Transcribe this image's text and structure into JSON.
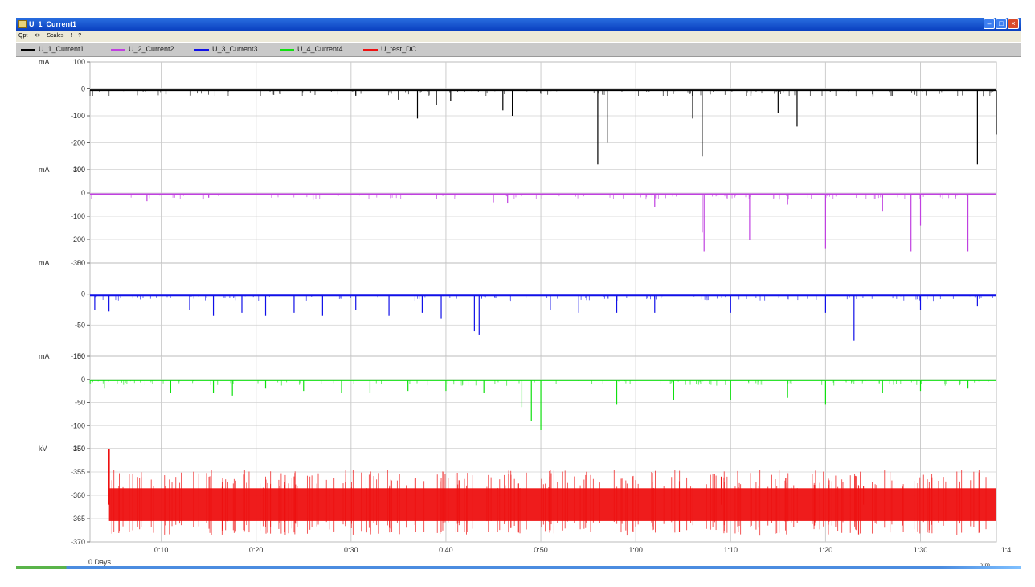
{
  "window": {
    "title": "U_1_Current1",
    "icon": "app-icon",
    "controls": [
      "minimize-icon",
      "maximize-icon",
      "close-icon"
    ]
  },
  "menu": {
    "items": [
      "Qpt",
      "<>",
      "Scales",
      "!",
      "?"
    ]
  },
  "legend": {
    "items": [
      {
        "label": "U_1_Current1",
        "color": "#000000"
      },
      {
        "label": "U_2_Current2",
        "color": "#c040e0"
      },
      {
        "label": "U_3_Current3",
        "color": "#1010e8"
      },
      {
        "label": "U_4_Current4",
        "color": "#10e010"
      },
      {
        "label": "U_test_DC",
        "color": "#ee1010"
      }
    ]
  },
  "x_axis": {
    "ticks": [
      "0:10",
      "0:20",
      "0:30",
      "0:40",
      "0:50",
      "1:00",
      "1:10",
      "1:20",
      "1:30",
      "1:4"
    ],
    "start_label": "0 Days",
    "unit": "h:m"
  },
  "chart_data": [
    {
      "type": "line",
      "series": [
        {
          "name": "U_1_Current1",
          "color": "#000000",
          "baseline": -5,
          "dips": [
            [
              10.5,
              -20
            ],
            [
              30.5,
              -25
            ],
            [
              35,
              -40
            ],
            [
              37,
              -110
            ],
            [
              39,
              -60
            ],
            [
              40.5,
              -45
            ],
            [
              46,
              -80
            ],
            [
              47,
              -100
            ],
            [
              56,
              -280
            ],
            [
              57,
              -200
            ],
            [
              66,
              -110
            ],
            [
              67,
              -250
            ],
            [
              75,
              -90
            ],
            [
              77,
              -140
            ],
            [
              85,
              -30
            ],
            [
              96,
              -280
            ],
            [
              98,
              -170
            ],
            [
              102,
              -220
            ],
            [
              104,
              -150
            ],
            [
              107,
              -200
            ],
            [
              111,
              -180
            ],
            [
              114,
              -270
            ],
            [
              116,
              -80
            ],
            [
              122,
              -100
            ],
            [
              125,
              -50
            ]
          ]
        }
      ],
      "y_unit": "mA",
      "ylim": [
        -300,
        100
      ],
      "yticks": [
        "100",
        "0",
        "-100",
        "-200",
        "-300"
      ],
      "xlim": [
        2.5,
        98
      ]
    },
    {
      "type": "line",
      "series": [
        {
          "name": "U_2_Current2",
          "color": "#c040e0",
          "baseline": -5,
          "dips": [
            [
              8.5,
              -35
            ],
            [
              15,
              -20
            ],
            [
              26,
              -30
            ],
            [
              39,
              -25
            ],
            [
              45,
              -40
            ],
            [
              46.5,
              -45
            ],
            [
              62,
              -60
            ],
            [
              67,
              -170
            ],
            [
              67.2,
              -250
            ],
            [
              72,
              -200
            ],
            [
              76,
              -50
            ],
            [
              80,
              -240
            ],
            [
              86,
              -80
            ],
            [
              89,
              -250
            ],
            [
              90,
              -140
            ],
            [
              95,
              -250
            ]
          ]
        }
      ],
      "y_unit": "mA",
      "ylim": [
        -300,
        100
      ],
      "yticks": [
        "100",
        "0",
        "-100",
        "-200",
        "-300"
      ],
      "xlim": [
        2.5,
        98
      ]
    },
    {
      "type": "line",
      "series": [
        {
          "name": "U_3_Current3",
          "color": "#1010e8",
          "baseline": -2,
          "dips": [
            [
              3,
              -25
            ],
            [
              4.5,
              -28
            ],
            [
              13,
              -25
            ],
            [
              15.5,
              -35
            ],
            [
              18.5,
              -30
            ],
            [
              21,
              -35
            ],
            [
              24,
              -30
            ],
            [
              27,
              -35
            ],
            [
              30.5,
              -25
            ],
            [
              34,
              -35
            ],
            [
              37.5,
              -30
            ],
            [
              39.5,
              -40
            ],
            [
              43,
              -60
            ],
            [
              43.5,
              -65
            ],
            [
              51,
              -25
            ],
            [
              54,
              -30
            ],
            [
              58,
              -30
            ],
            [
              62,
              -30
            ],
            [
              70,
              -30
            ],
            [
              80,
              -30
            ],
            [
              83,
              -75
            ],
            [
              90,
              -25
            ],
            [
              96,
              -20
            ]
          ]
        }
      ],
      "y_unit": "mA",
      "ylim": [
        -100,
        50
      ],
      "yticks": [
        "50",
        "0",
        "-50",
        "-100"
      ],
      "xlim": [
        2.5,
        98
      ]
    },
    {
      "type": "line",
      "series": [
        {
          "name": "U_4_Current4",
          "color": "#10e010",
          "baseline": -2,
          "dips": [
            [
              4,
              -20
            ],
            [
              11,
              -30
            ],
            [
              15.5,
              -30
            ],
            [
              17.5,
              -35
            ],
            [
              21,
              -20
            ],
            [
              25,
              -25
            ],
            [
              29,
              -30
            ],
            [
              32,
              -30
            ],
            [
              36,
              -25
            ],
            [
              40,
              -25
            ],
            [
              44,
              -30
            ],
            [
              48,
              -60
            ],
            [
              49,
              -90
            ],
            [
              50,
              -110
            ],
            [
              58,
              -55
            ],
            [
              64,
              -45
            ],
            [
              70,
              -45
            ],
            [
              76,
              -40
            ],
            [
              80,
              -55
            ],
            [
              86,
              -30
            ],
            [
              90,
              -25
            ],
            [
              95,
              -20
            ]
          ]
        }
      ],
      "y_unit": "mA",
      "ylim": [
        -150,
        50
      ],
      "yticks": [
        "50",
        "0",
        "-50",
        "-100",
        "-150"
      ],
      "xlim": [
        2.5,
        98
      ]
    },
    {
      "type": "line",
      "series": [
        {
          "name": "U_test_DC",
          "color": "#ee1010",
          "baseline": -362,
          "band": 3.5,
          "spikes": [
            [
              4.5,
              -350
            ],
            [
              69,
              -356
            ],
            [
              84,
              -358
            ]
          ]
        }
      ],
      "y_unit": "kV",
      "ylim": [
        -370,
        -350
      ],
      "yticks": [
        "-350",
        "-355",
        "-360",
        "-365",
        "-370"
      ],
      "xlim": [
        2.5,
        98
      ]
    }
  ]
}
